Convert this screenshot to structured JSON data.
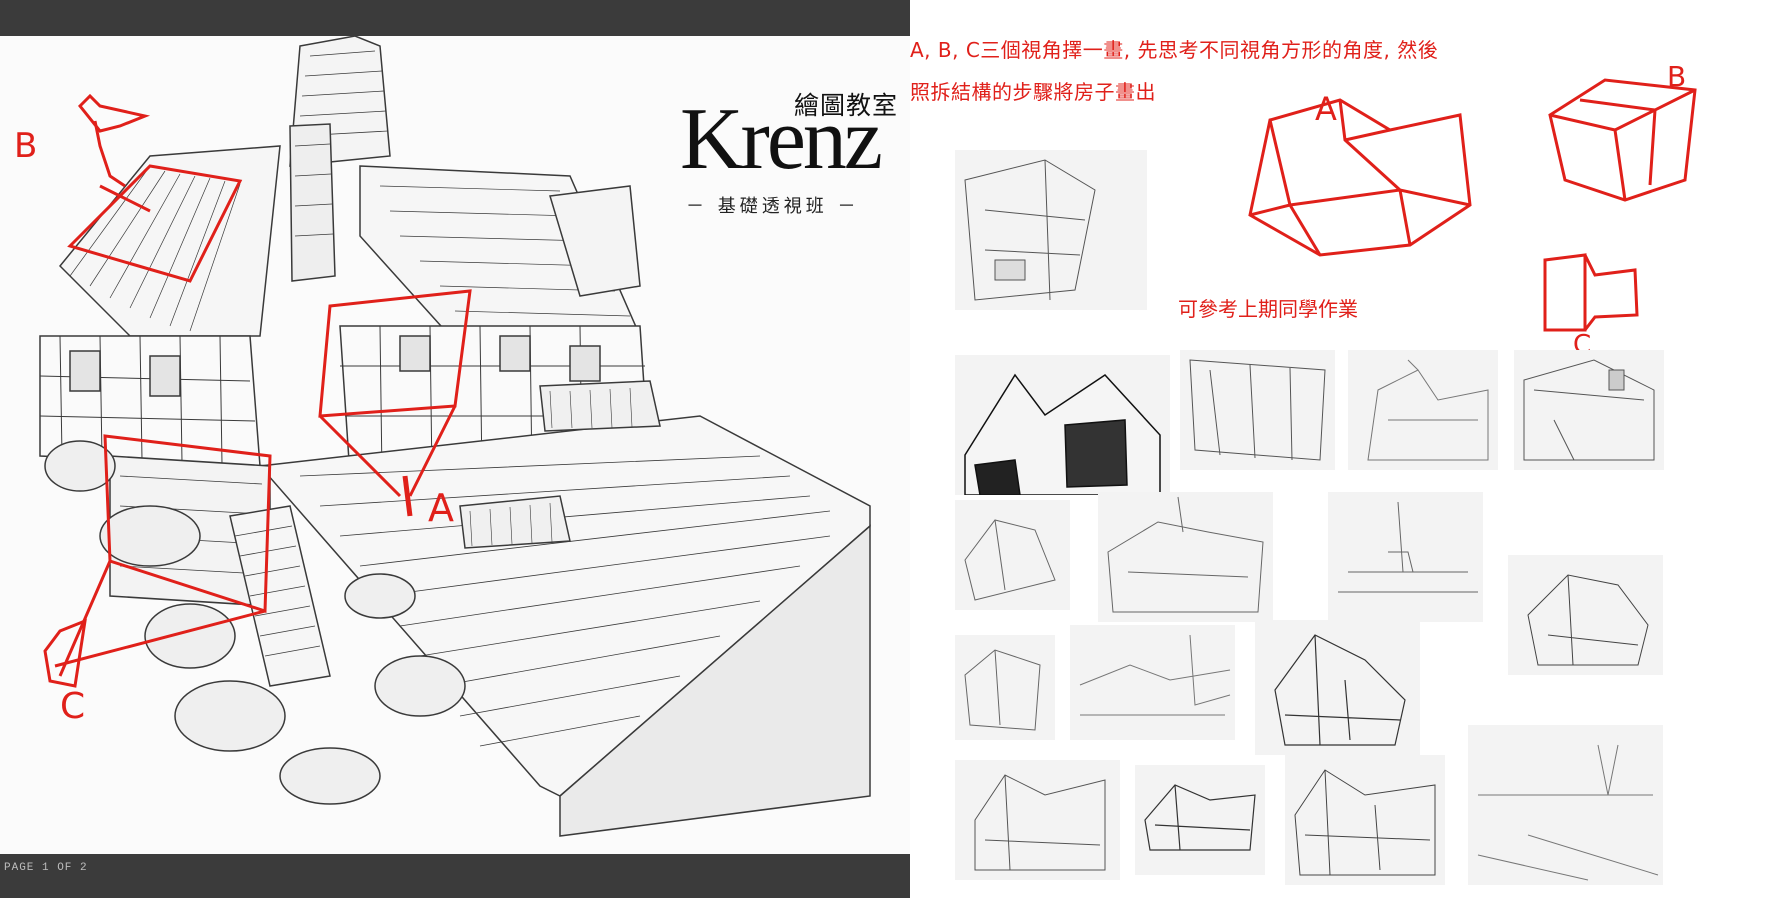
{
  "logo": {
    "top_text": "繪圖教室",
    "main_text": "Krenz",
    "sub_text": "－ 基礎透視班 －"
  },
  "page_label": "PAGE 1 OF 2",
  "instructions": {
    "line1": "A, B, C三個視角擇一畫, 先思考不同視角方形的角度, 然後",
    "line2": "照拆結構的步驟將房子畫出"
  },
  "reference_note": "可參考上期同學作業",
  "markers": {
    "view_a": "A",
    "view_b": "B",
    "view_c": "C"
  },
  "colors": {
    "annotation_red": "#e0201a",
    "frame_dark": "#3b3b3b",
    "line_art": "#333333"
  },
  "thumbnails_count": 18
}
